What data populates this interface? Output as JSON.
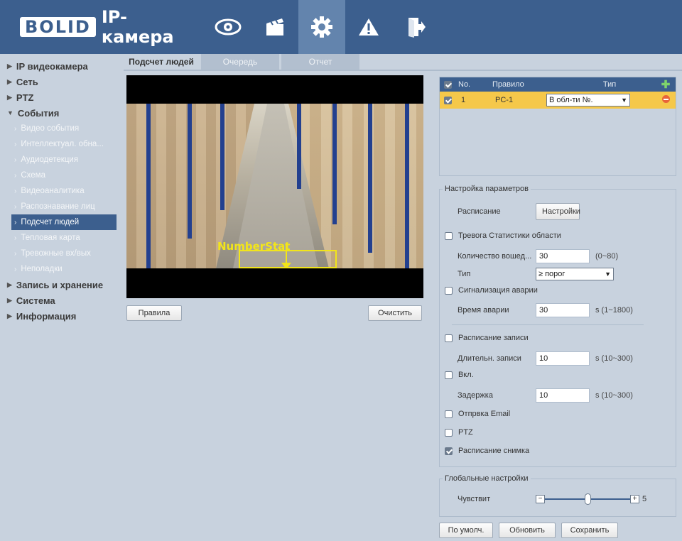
{
  "brand": {
    "logo_word": "BOLID",
    "title": "IP-камера"
  },
  "nav_icons": [
    {
      "name": "live-view-icon",
      "active": false
    },
    {
      "name": "playback-icon",
      "active": false
    },
    {
      "name": "settings-icon",
      "active": true
    },
    {
      "name": "alarm-icon",
      "active": false
    },
    {
      "name": "logout-icon",
      "active": false
    }
  ],
  "sidebar": {
    "items": [
      {
        "label": "IP видеокамера"
      },
      {
        "label": "Сеть"
      },
      {
        "label": "PTZ"
      },
      {
        "label": "События"
      },
      {
        "label": "Запись и хранение"
      },
      {
        "label": "Система"
      },
      {
        "label": "Информация"
      }
    ],
    "events_sub": [
      {
        "label": "Видео события"
      },
      {
        "label": "Интеллектуал. обна..."
      },
      {
        "label": "Аудиодетекция"
      },
      {
        "label": "Схема"
      },
      {
        "label": "Видеоаналитика"
      },
      {
        "label": "Распознавание лиц"
      },
      {
        "label": "Подсчет людей"
      },
      {
        "label": "Тепловая карта"
      },
      {
        "label": "Тревожные вх/вых"
      },
      {
        "label": "Неполадки"
      }
    ]
  },
  "tabs": [
    {
      "label": "Подсчет людей"
    },
    {
      "label": "Очередь"
    },
    {
      "label": "Отчет"
    }
  ],
  "video": {
    "overlay_label": "NumberStat"
  },
  "buttons": {
    "rules": "Правила",
    "clear": "Очистить",
    "settings": "Настройки",
    "default": "По умолч.",
    "refresh": "Обновить",
    "save": "Сохранить"
  },
  "rule_table": {
    "headers": {
      "no": "No.",
      "rule": "Правило",
      "type": "Тип"
    },
    "rows": [
      {
        "no": "1",
        "rule": "PC-1",
        "type": "В обл-ти №."
      }
    ]
  },
  "params": {
    "legend": "Настройка параметров",
    "schedule_label": "Расписание",
    "area_alarm_label": "Тревога Статистики области",
    "count_label": "Количество вошед...",
    "count_value": "30",
    "count_range": "(0~80)",
    "type_label": "Тип",
    "type_value": "≥ порог",
    "alarm_signal_label": "Сигнализация аварии",
    "alarm_time_label": "Время аварии",
    "alarm_time_value": "30",
    "alarm_time_range": "s (1~1800)",
    "record_schedule_label": "Расписание записи",
    "record_duration_label": "Длительн. записи",
    "record_duration_value": "10",
    "record_duration_range": "s (10~300)",
    "enable_label": "Вкл.",
    "delay_label": "Задержка",
    "delay_value": "10",
    "delay_range": "s (10~300)",
    "email_label": "Отпрвка Email",
    "ptz_label": "PTZ",
    "snapshot_label": "Расписание снимка"
  },
  "global": {
    "legend": "Глобальные настройки",
    "sensitivity_label": "Чувствит",
    "sensitivity_value": "5",
    "minus": "−",
    "plus": "+"
  },
  "colors": {
    "header": "#3c5f8e",
    "panel": "#c8d2de",
    "selected_row": "#f5c84a",
    "overlay": "#f2e51a"
  }
}
